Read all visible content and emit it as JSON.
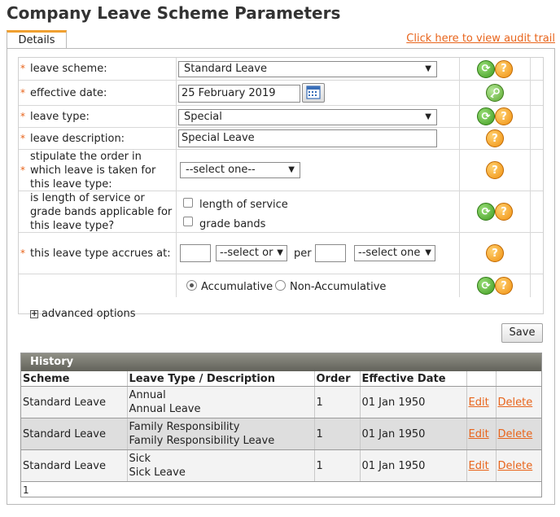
{
  "page": {
    "title": "Company Leave Scheme Parameters"
  },
  "tabs": {
    "details": "Details"
  },
  "audit_link": "Click here to view audit trail",
  "form": {
    "required_marker": "*",
    "leave_scheme": {
      "label": "leave scheme:",
      "value": "Standard Leave"
    },
    "effective_date": {
      "label": "effective date:",
      "value": "25 February  2019"
    },
    "leave_type": {
      "label": "leave type:",
      "value": "Special"
    },
    "leave_description": {
      "label": "leave description:",
      "value": "Special Leave"
    },
    "stipulate_order": {
      "label": "stipulate the order in which leave is taken for this leave type:",
      "value": "--select one--"
    },
    "service_grade": {
      "label": "is length of service or grade bands applicable for this leave type?",
      "options": [
        "length of service",
        "grade bands"
      ]
    },
    "accrues": {
      "label": "this leave type accrues at:",
      "select1": "--select or",
      "per_label": "per",
      "select2": "--select one"
    },
    "accumulation": {
      "options": [
        "Accumulative",
        "Non-Accumulative"
      ],
      "selected": "Accumulative"
    },
    "advanced_options": "advanced options"
  },
  "actions": {
    "save": "Save"
  },
  "history": {
    "title": "History",
    "columns": [
      "Scheme",
      "Leave Type / Description",
      "Order",
      "Effective Date",
      "",
      ""
    ],
    "rows": [
      {
        "scheme": "Standard Leave",
        "type": "Annual",
        "description": "Annual Leave",
        "order": "1",
        "date": "01 Jan 1950",
        "edit": "Edit",
        "delete": "Delete"
      },
      {
        "scheme": "Standard Leave",
        "type": "Family Responsibility",
        "description": "Family Responsibility Leave",
        "order": "1",
        "date": "01 Jan 1950",
        "edit": "Edit",
        "delete": "Delete"
      },
      {
        "scheme": "Standard Leave",
        "type": "Sick",
        "description": "Sick Leave",
        "order": "1",
        "date": "01 Jan 1950",
        "edit": "Edit",
        "delete": "Delete"
      }
    ],
    "pager": "1"
  },
  "icons": {
    "refresh": "refresh-icon",
    "help": "help-icon",
    "key": "key-icon",
    "calendar": "calendar-icon"
  },
  "colors": {
    "accent": "#e8641b",
    "history_header": "#6e6e66"
  }
}
